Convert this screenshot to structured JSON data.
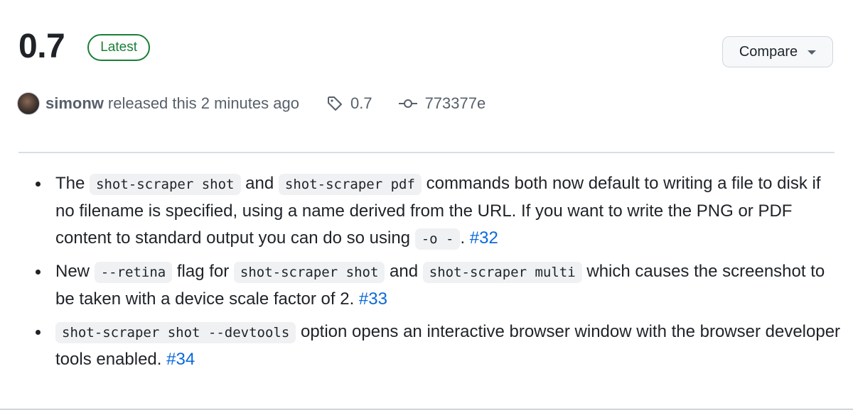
{
  "release": {
    "version": "0.7",
    "badge": "Latest",
    "compare_label": "Compare"
  },
  "meta": {
    "author": "simonw",
    "released_text": "released this 2 minutes ago",
    "tag": "0.7",
    "commit": "773377e"
  },
  "notes": [
    {
      "t1": "The ",
      "c1": "shot-scraper shot",
      "t2": " and ",
      "c2": "shot-scraper pdf",
      "t3": " commands both now default to writing a file to disk if no filename is specified, using a name derived from the URL. If you want to write the PNG or PDF content to standard output you can do so using ",
      "c3": "-o -",
      "t4": ". ",
      "link": "#32"
    },
    {
      "t1": "New ",
      "c1": "--retina",
      "t2": " flag for ",
      "c2": "shot-scraper shot",
      "t3": " and ",
      "c3": "shot-scraper multi",
      "t4": " which causes the screenshot to be taken with a device scale factor of 2. ",
      "link": "#33"
    },
    {
      "c1": "shot-scraper shot --devtools",
      "t1": " option opens an interactive browser window with the browser developer tools enabled. ",
      "link": "#34"
    }
  ],
  "colors": {
    "badge_green": "#1a7f37",
    "link_blue": "#0969da",
    "muted_text": "#57606a",
    "code_bg": "#eff1f3"
  },
  "icons": [
    "tag-icon",
    "git-commit-icon",
    "chevron-down-icon",
    "avatar"
  ]
}
